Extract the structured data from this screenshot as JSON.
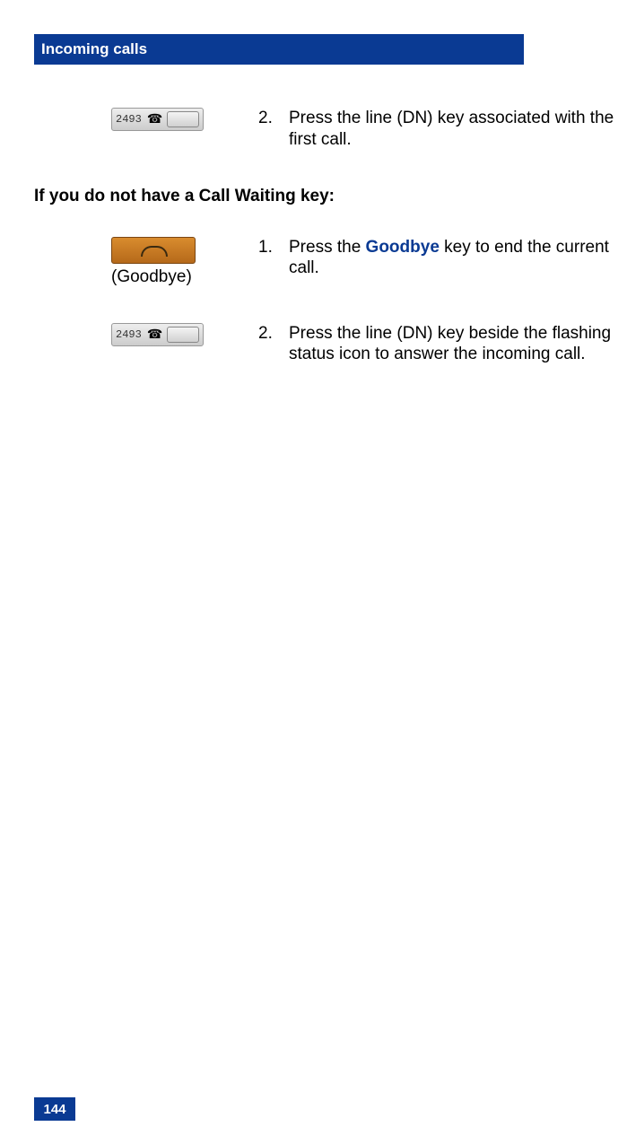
{
  "header": {
    "title": "Incoming calls"
  },
  "step_top": {
    "dn_number": "2493",
    "num": "2.",
    "text": "Press the line (DN) key associated with the first call."
  },
  "subhead": "If you do not have a Call Waiting key:",
  "step_a": {
    "button_label": "(Goodbye)",
    "num": "1.",
    "text_before": "Press the ",
    "keyword": "Goodbye",
    "text_after": " key to end the current call."
  },
  "step_b": {
    "dn_number": "2493",
    "num": "2.",
    "text": "Press the line (DN) key beside the flashing status icon to answer the incoming call."
  },
  "page_number": "144"
}
